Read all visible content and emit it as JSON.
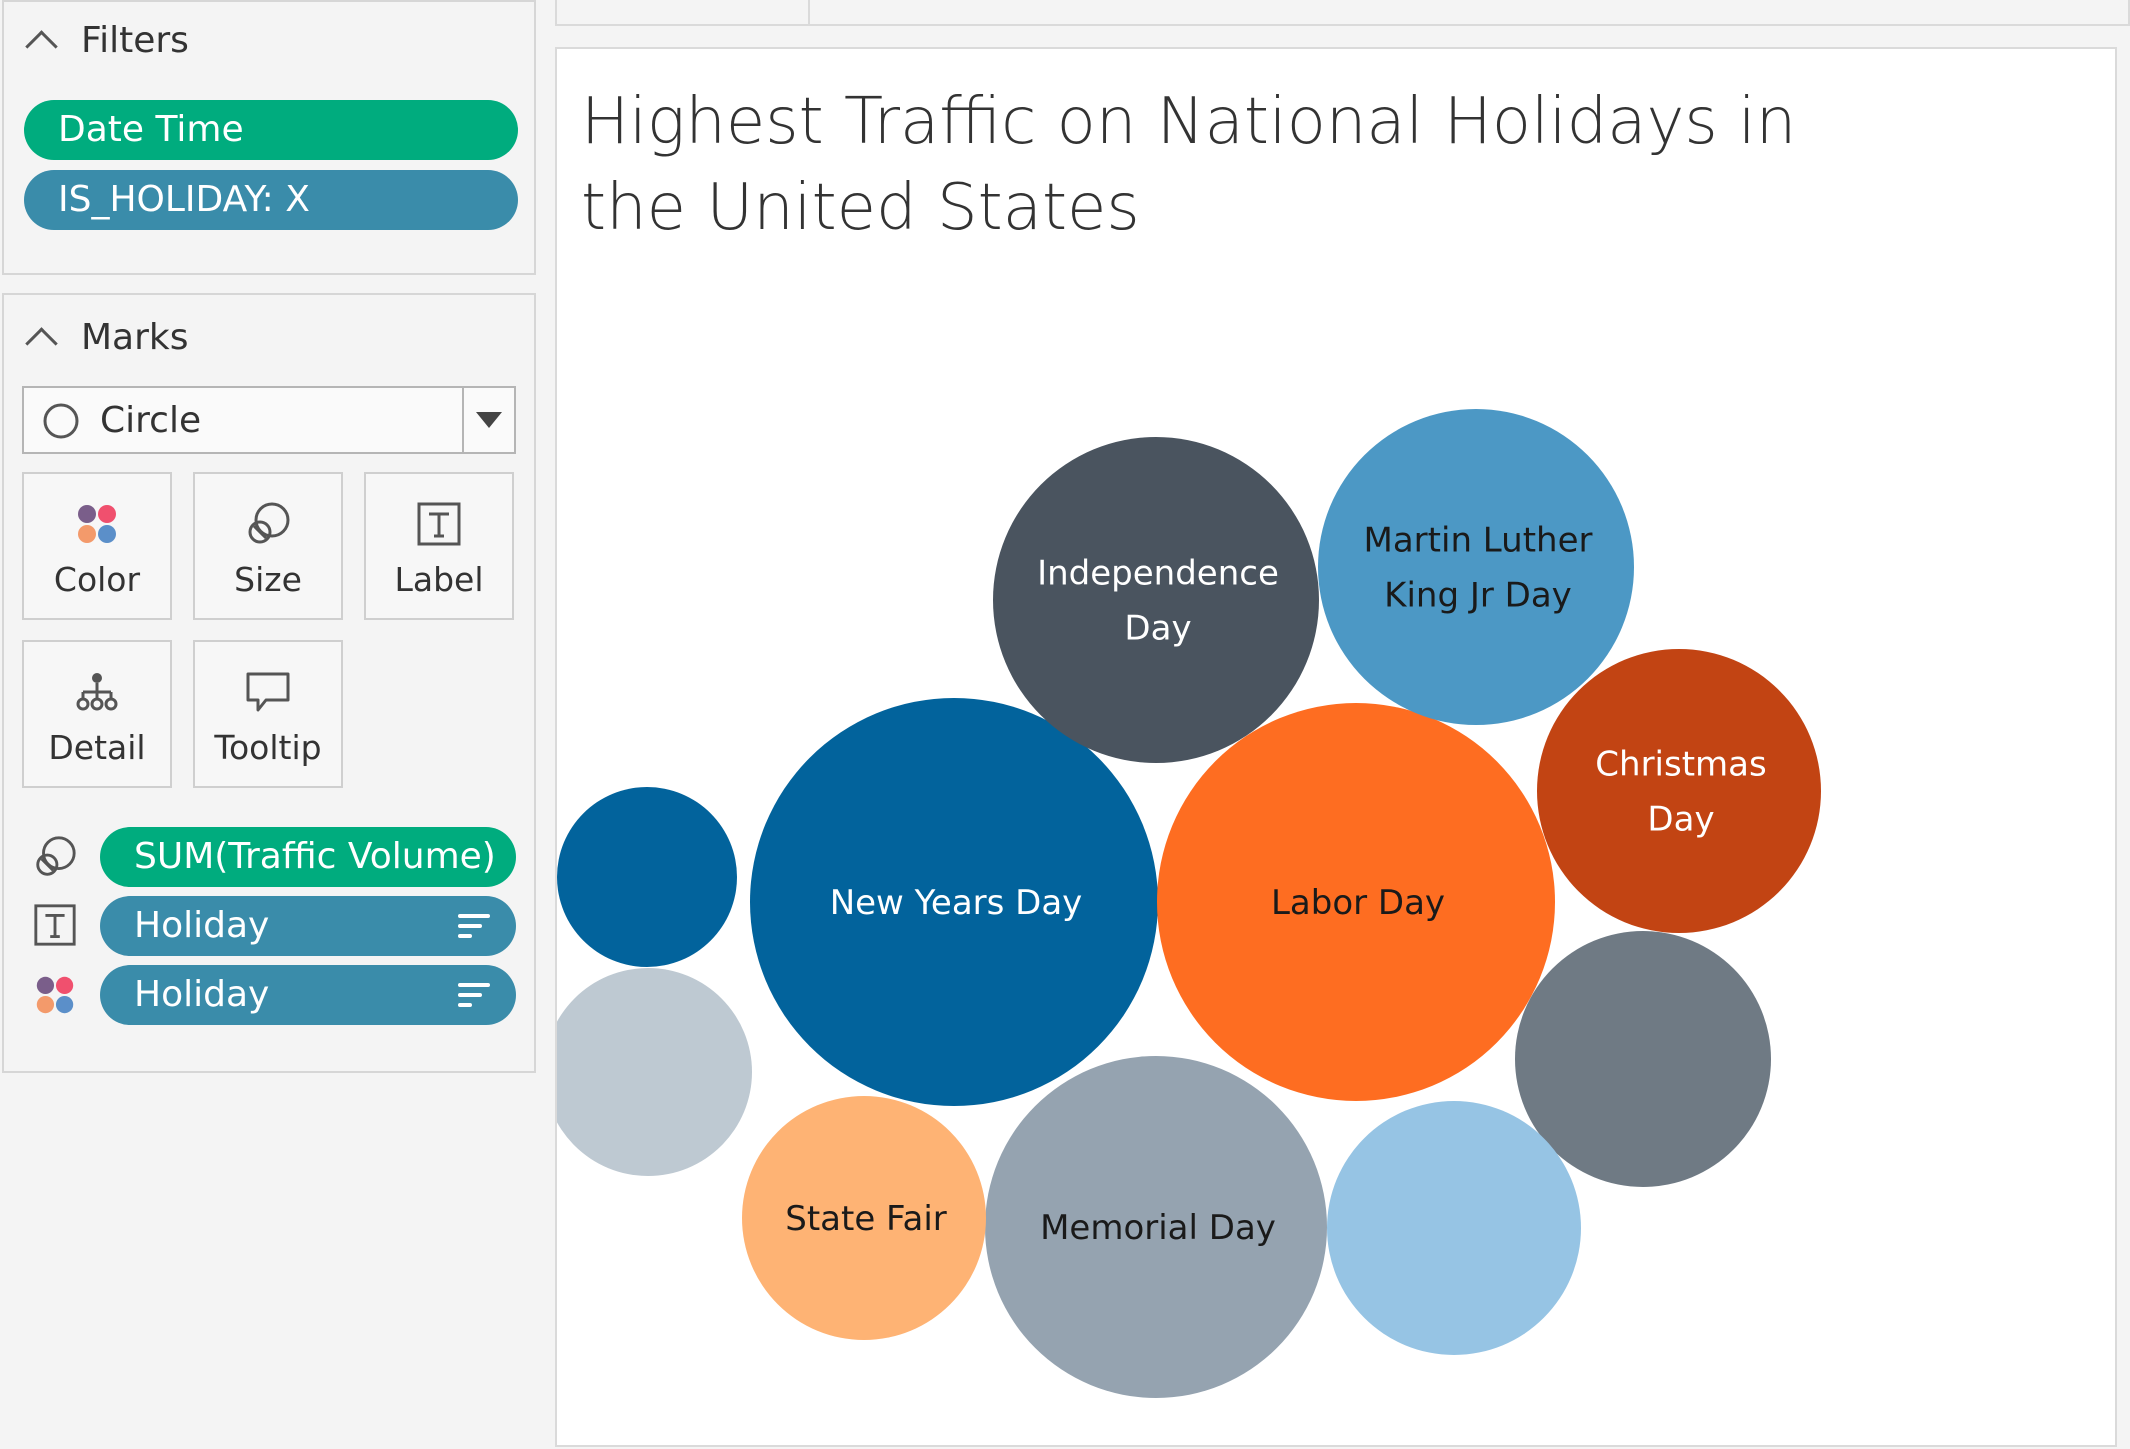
{
  "filters": {
    "header": "Filters",
    "pills": [
      {
        "label": "Date Time",
        "color": "#00ac7e"
      },
      {
        "label": "IS_HOLIDAY: X",
        "color": "#3a8caa"
      }
    ]
  },
  "marks": {
    "header": "Marks",
    "mark_type": "Circle",
    "buttons": {
      "color": "Color",
      "size": "Size",
      "label": "Label",
      "detail": "Detail",
      "tooltip": "Tooltip"
    },
    "shelf": [
      {
        "role": "size",
        "field": "SUM(Traffic Volume)",
        "color": "#00ac7e"
      },
      {
        "role": "label",
        "field": "Holiday",
        "color": "#3a8caa"
      },
      {
        "role": "color",
        "field": "Holiday",
        "color": "#3a8caa"
      }
    ]
  },
  "view": {
    "title": "Highest Traffic on National Holidays in the United States"
  },
  "chart_data": {
    "type": "bubble",
    "measure": "SUM(Traffic Volume)",
    "dimension": "Holiday",
    "labels": [
      "Independence Day",
      "Martin Luther King Jr Day",
      "New Years Day",
      "Labor Day",
      "Christmas Day",
      "State Fair",
      "Memorial Day"
    ],
    "bubbles": [
      {
        "label": "New Years Day",
        "color": "#02639c",
        "text_color": "#ffffff"
      },
      {
        "label": "Labor Day",
        "color": "#fe6d21",
        "text_color": "#1a1a1a"
      },
      {
        "label": "Memorial Day",
        "color": "#95a3b0",
        "text_color": "#1a1a1a"
      },
      {
        "label": "Independence Day",
        "color": "#4a545f",
        "text_color": "#ffffff"
      },
      {
        "label": "Martin Luther King Jr Day",
        "color": "#4c98c5",
        "text_color": "#1a1a1a"
      },
      {
        "label": "Christmas Day",
        "color": "#c24413",
        "text_color": "#ffffff"
      },
      {
        "label": "State Fair",
        "color": "#feb374",
        "text_color": "#1a1a1a"
      },
      {
        "label": "",
        "color": "#6f7a84"
      },
      {
        "label": "",
        "color": "#96c4e4"
      },
      {
        "label": "",
        "color": "#bec9d2"
      },
      {
        "label": "",
        "color": "#02639c"
      }
    ]
  }
}
